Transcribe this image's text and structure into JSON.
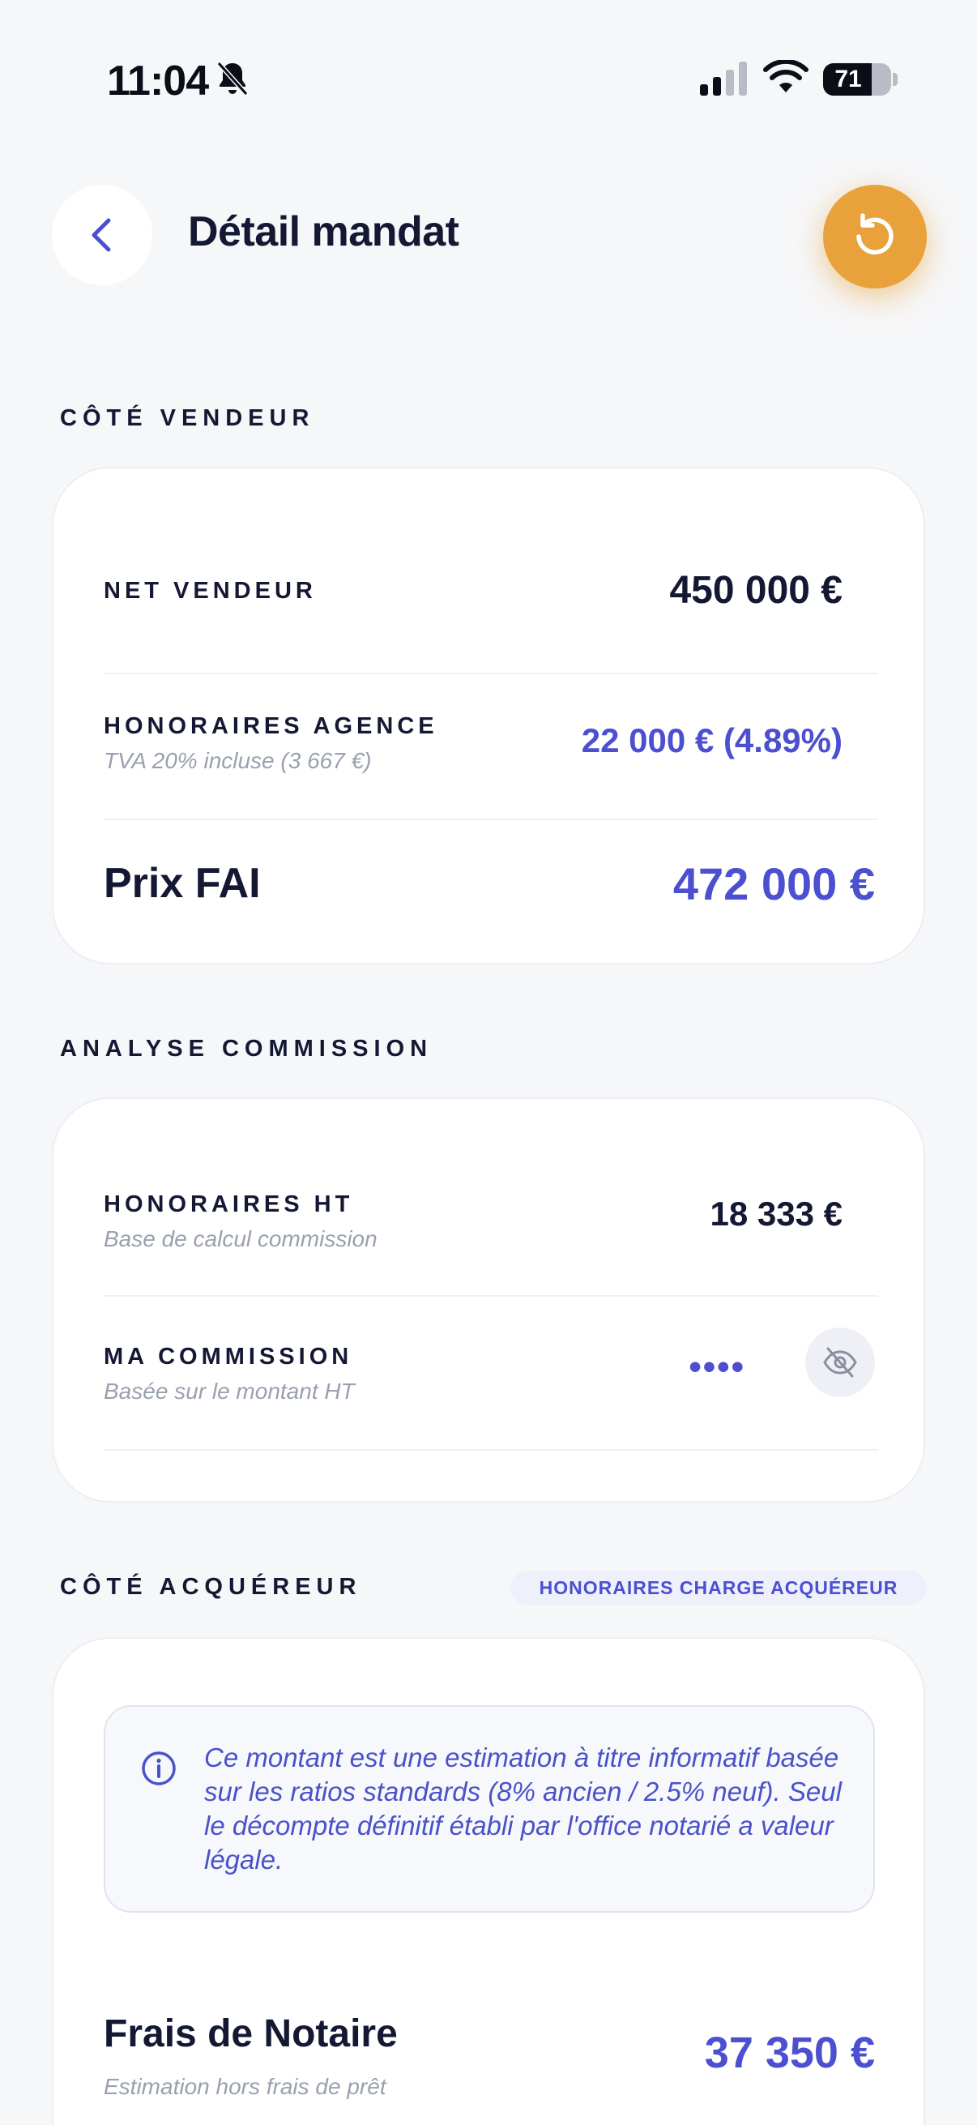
{
  "status_bar": {
    "time": "11:04",
    "battery": "71",
    "battery_level": 0.71
  },
  "header": {
    "title": "Détail mandat"
  },
  "seller": {
    "heading": "CÔTÉ VENDEUR",
    "net_label": "NET VENDEUR",
    "net_value": "450 000 €",
    "fees_label": "HONORAIRES AGENCE",
    "fees_sublabel": "TVA 20% incluse (3 667 €)",
    "fees_value": "22 000 € (4.89%)",
    "fai_label": "Prix FAI",
    "fai_value": "472 000 €"
  },
  "commission": {
    "heading": "ANALYSE COMMISSION",
    "ht_label": "HONORAIRES HT",
    "ht_sublabel": "Base de calcul commission",
    "ht_value": "18 333 €",
    "mine_label": "MA COMMISSION",
    "mine_sublabel": "Basée sur le montant HT",
    "mine_value_masked": "••••"
  },
  "buyer": {
    "heading": "CÔTÉ ACQUÉREUR",
    "badge": "HONORAIRES CHARGE ACQUÉREUR",
    "info_text": "Ce montant est une estimation à titre informatif basée sur les ratios standards (8% ancien / 2.5% neuf). Seul le décompte définitif établi par l'office notarié a valeur légale.",
    "notary_label": "Frais de Notaire",
    "notary_sublabel": "Estimation hors frais de prêt",
    "notary_value": "37 350 €"
  },
  "colors": {
    "accent": "#4b4fd0",
    "reset_button": "#e9a23b",
    "text": "#141833",
    "muted": "#9aa0ae"
  }
}
